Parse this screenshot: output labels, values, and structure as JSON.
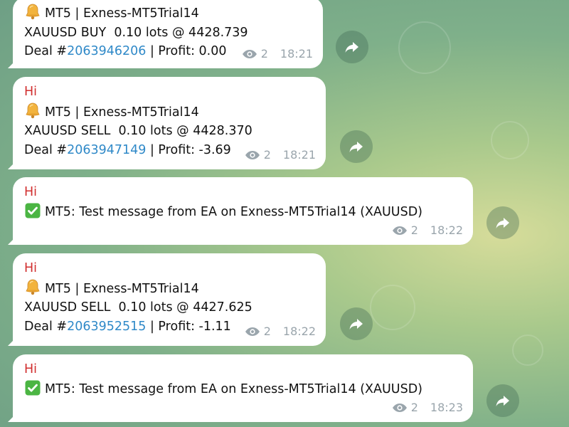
{
  "messages": [
    {
      "sender": "",
      "lines": [
        "MT5 | Exness-MT5Trial14",
        "XAUUSD BUY  0.10 lots @ 4428.739"
      ],
      "deal_prefix": "Deal #",
      "deal_id": "2063946206",
      "profit": " | Profit: 0.00",
      "views": "2",
      "time": "18:21",
      "icon": "bell"
    },
    {
      "sender": "Hi",
      "lines": [
        "MT5 | Exness-MT5Trial14",
        "XAUUSD SELL  0.10 lots @ 4428.370"
      ],
      "deal_prefix": "Deal #",
      "deal_id": "2063947149",
      "profit": " | Profit: -3.69",
      "views": "2",
      "time": "18:21",
      "icon": "bell"
    },
    {
      "sender": "Hi",
      "text": "MT5: Test message from EA on Exness-MT5Trial14 (XAUUSD)",
      "views": "2",
      "time": "18:22",
      "icon": "check"
    },
    {
      "sender": "Hi",
      "lines": [
        "MT5 | Exness-MT5Trial14",
        "XAUUSD SELL  0.10 lots @ 4427.625"
      ],
      "deal_prefix": "Deal #",
      "deal_id": "2063952515",
      "profit": " | Profit: -1.11",
      "views": "2",
      "time": "18:22",
      "icon": "bell"
    },
    {
      "sender": "Hi",
      "text": "MT5: Test message from EA on Exness-MT5Trial14 (XAUUSD)",
      "views": "2",
      "time": "18:23",
      "icon": "check"
    }
  ],
  "colors": {
    "sender": "#d12f2f",
    "link": "#2f89c8",
    "meta": "#9aa5ac"
  }
}
